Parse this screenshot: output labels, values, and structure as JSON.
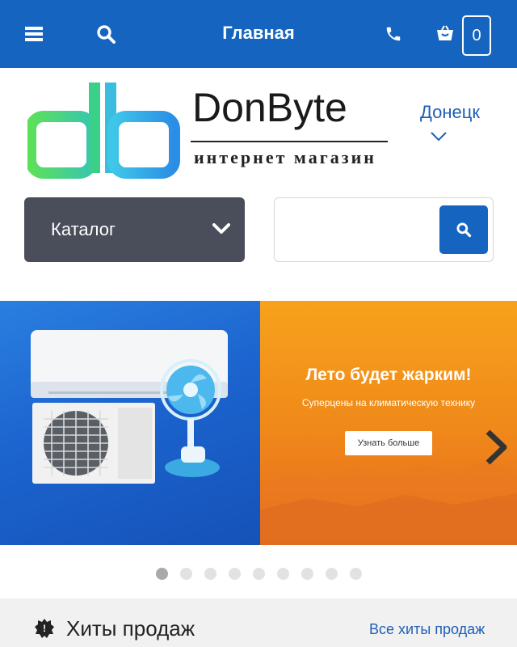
{
  "header": {
    "title": "Главная",
    "menu_icon": "menu-icon",
    "search_icon": "search-icon",
    "phone_icon": "phone-icon",
    "cart_icon": "basket-icon",
    "cart_count": "0",
    "bg_color": "#1565c0"
  },
  "brand": {
    "name": "DonByte",
    "subtitle": "интернет магазин",
    "logo_letters": "db"
  },
  "city": {
    "label": "Донецк"
  },
  "catalog": {
    "label": "Каталог"
  },
  "search": {
    "placeholder": ""
  },
  "banner": {
    "title": "Лето будет жарким!",
    "subtitle": "Суперцены на климатическую технику",
    "cta": "Узнать больше",
    "slide_count": 9,
    "active_slide": 1
  },
  "section": {
    "title": "Хиты продаж",
    "link": "Все хиты продаж"
  }
}
